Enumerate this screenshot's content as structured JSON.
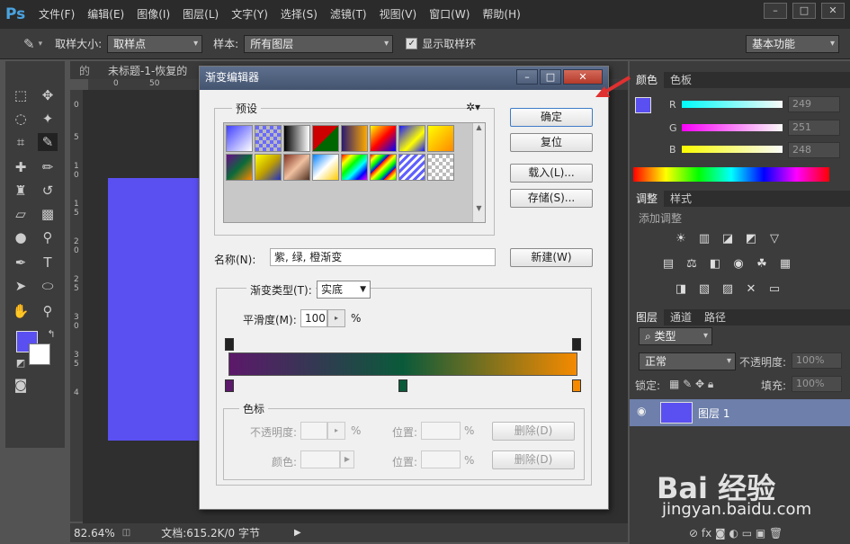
{
  "app": {
    "logo": "Ps"
  },
  "menu": [
    "文件(F)",
    "编辑(E)",
    "图像(I)",
    "图层(L)",
    "文字(Y)",
    "选择(S)",
    "滤镜(T)",
    "视图(V)",
    "窗口(W)",
    "帮助(H)"
  ],
  "window_controls": {
    "minimize": "–",
    "restore": "□",
    "close": "✕"
  },
  "options": {
    "sample_size_label": "取样大小:",
    "sample_size_value": "取样点",
    "sample_label": "样本:",
    "sample_value": "所有图层",
    "show_ring_label": "显示取样环",
    "show_ring_checked": true,
    "workspace": "基本功能"
  },
  "document": {
    "tab_partial": "的",
    "tab_title": "未标题-1-恢复的",
    "ruler_ticks": [
      "0",
      "50"
    ],
    "ruler_left_ticks": [
      "0",
      "5",
      "1",
      "0",
      "1",
      "5",
      "2",
      "0",
      "2",
      "5",
      "3",
      "0",
      "3",
      "5",
      "4"
    ],
    "zoom": "82.64%",
    "doc_info": "文档:615.2K/0 字节"
  },
  "colors": {
    "foreground": "#5a4ff0",
    "background": "#ffffff",
    "canvas_fill": "#5a4ff0"
  },
  "color_panel": {
    "tabs": [
      "颜色",
      "色板"
    ],
    "channels": [
      {
        "label": "R",
        "value": "249"
      },
      {
        "label": "G",
        "value": "251"
      },
      {
        "label": "B",
        "value": "248"
      }
    ]
  },
  "adjust_panel": {
    "tabs": [
      "调整",
      "样式"
    ],
    "heading": "添加调整"
  },
  "layers_panel": {
    "tabs": [
      "图层",
      "通道",
      "路径"
    ],
    "filter_label": "类型",
    "blend_mode": "正常",
    "opacity_label": "不透明度:",
    "opacity_value": "100%",
    "lock_label": "锁定:",
    "fill_label": "填充:",
    "fill_value": "100%",
    "layer_name": "图层 1"
  },
  "gradient_editor": {
    "title": "渐变编辑器",
    "presets_label": "预设",
    "buttons": {
      "ok": "确定",
      "reset": "复位",
      "load": "载入(L)...",
      "save": "存储(S)...",
      "new": "新建(W)"
    },
    "name_label": "名称(N):",
    "name_value": "紫, 绿, 橙渐变",
    "type_label": "渐变类型(T):",
    "type_value": "实底",
    "smoothness_label": "平滑度(M):",
    "smoothness_value": "100",
    "smoothness_unit": "%",
    "stops_group_label": "色标",
    "opacity_label": "不透明度:",
    "color_label": "颜色:",
    "position_label": "位置:",
    "percent": "%",
    "delete_label": "删除(D)",
    "stop_colors": [
      "#5c186a",
      "#0a5a3a",
      "#f58a00"
    ]
  },
  "watermark": {
    "brand": "Bai  经验",
    "url": "jingyan.baidu.com"
  }
}
